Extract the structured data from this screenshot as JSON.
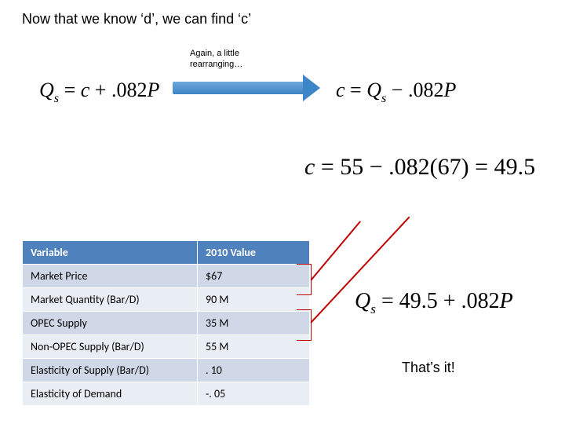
{
  "title": "Now that we know ‘d’, we can find ‘c’",
  "rearr_label": "Again, a little rearranging…",
  "eq": {
    "left_html": "<i>Q<span class='sub'>s</span></i> = <i>c</i> + .082<i>P</i>",
    "right_html": "<i>c</i> = <i>Q<span class='sub'>s</span></i> − .082<i>P</i>",
    "big_html": "<i>c</i> = 55 − .082(67) = 49.5",
    "final_html": "<i>Q<span class='sub'>s</span></i> = 49.5 + .082<i>P</i>"
  },
  "table": {
    "headers": [
      "Variable",
      "2010 Value"
    ],
    "rows": [
      {
        "v": "Market Price",
        "val": "$67"
      },
      {
        "v": "Market Quantity (Bar/D)",
        "val": "90 M"
      },
      {
        "v": "OPEC Supply",
        "val": "35 M"
      },
      {
        "v": "Non-OPEC Supply (Bar/D)",
        "val": "55 M"
      },
      {
        "v": "Elasticity of Supply (Bar/D)",
        "val": ". 10"
      },
      {
        "v": "Elasticity of Demand",
        "val": "-. 05"
      }
    ]
  },
  "thatsit": "That’s it!"
}
